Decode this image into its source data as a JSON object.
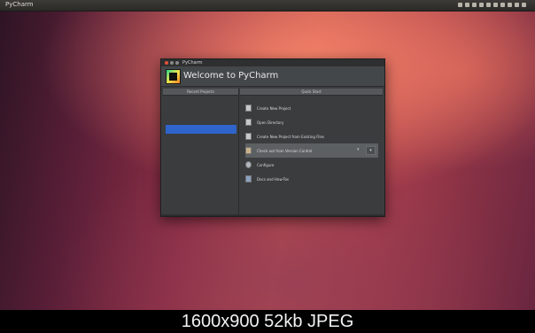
{
  "desktop": {
    "topbar_title": "PyCharm"
  },
  "window": {
    "title": "PyCharm",
    "welcome_title": "Welcome to PyCharm",
    "left_header": "Recent Projects",
    "right_header": "Quick Start",
    "recent_projects": [
      {
        "name": "",
        "path": ""
      },
      {
        "name": "",
        "path": ""
      },
      {
        "name": "",
        "path": ""
      },
      {
        "name": "",
        "path": ""
      },
      {
        "name": "",
        "path": ""
      },
      {
        "name": "",
        "path": ""
      }
    ],
    "actions": [
      {
        "label": "Create New Project",
        "icon": "new-project-icon"
      },
      {
        "label": "Open Directory",
        "icon": "open-folder-icon"
      },
      {
        "label": "Create New Project from Existing Files",
        "icon": "existing-files-icon"
      },
      {
        "label": "Check out from Version Control",
        "icon": "vcs-icon"
      },
      {
        "label": "Configure",
        "icon": "gear-icon"
      },
      {
        "label": "Docs and How-Tos",
        "icon": "help-icon"
      }
    ]
  },
  "caption": "1600x900 52kb JPEG"
}
